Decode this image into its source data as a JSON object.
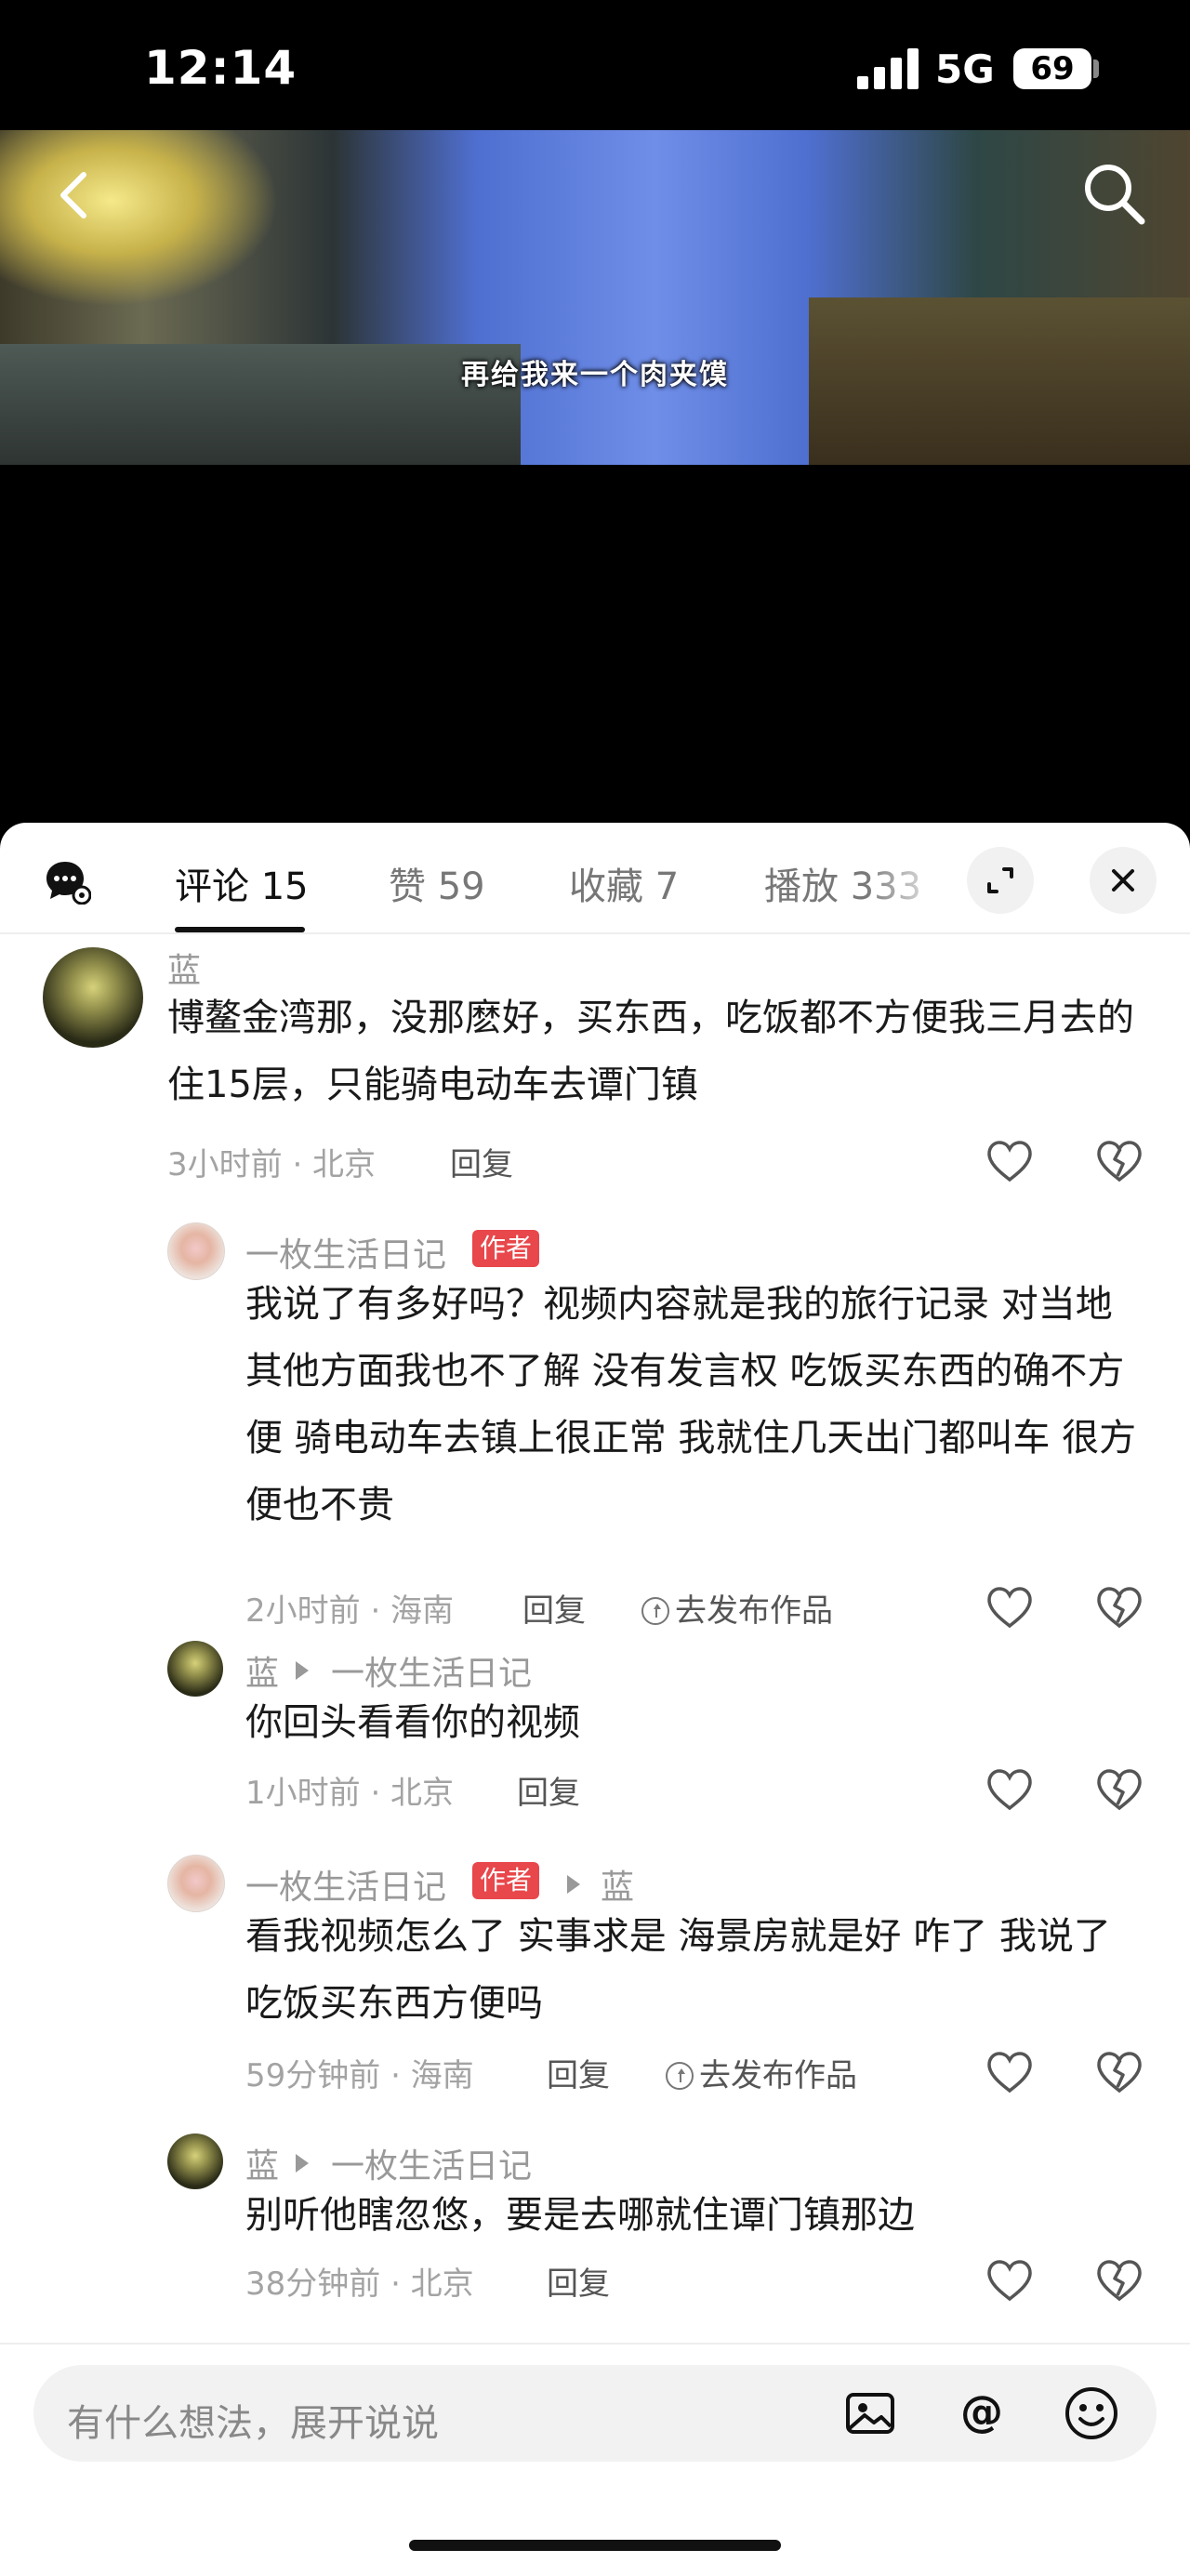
{
  "status": {
    "time": "12:14",
    "network": "5G",
    "battery": "69"
  },
  "video": {
    "subtitle": "再给我来一个肉夹馍"
  },
  "tabs": {
    "comments": "评论 15",
    "likes": "赞 59",
    "favorites": "收藏 7",
    "plays": "播放 333"
  },
  "comments": [
    {
      "user": "蓝",
      "text": "博鳌金湾那，没那麽好，买东西，吃饭都不方便我三月去的住15层，只能骑电动车去谭门镇",
      "meta": "3小时前 · 北京",
      "reply": "回复"
    },
    {
      "user": "一枚生活日记",
      "badge": "作者",
      "text": "我说了有多好吗？视频内容就是我的旅行记录 对当地其他方面我也不了解 没有发言权 吃饭买东西的确不方便 骑电动车去镇上很正常 我就住几天出门都叫车 很方便也不贵",
      "meta": "2小时前 · 海南",
      "reply": "回复",
      "publish": "去发布作品"
    },
    {
      "user": "蓝",
      "to": "一枚生活日记",
      "text": "你回头看看你的视频",
      "meta": "1小时前 · 北京",
      "reply": "回复"
    },
    {
      "user": "一枚生活日记",
      "badge": "作者",
      "to": "蓝",
      "text": "看我视频怎么了 实事求是 海景房就是好 咋了 我说了吃饭买东西方便吗",
      "meta": "59分钟前 · 海南",
      "reply": "回复",
      "publish": "去发布作品"
    },
    {
      "user": "蓝",
      "to": "一枚生活日记",
      "text": "别听他瞎忽悠，要是去哪就住谭门镇那边",
      "meta": "38分钟前 · 北京",
      "reply": "回复"
    }
  ],
  "input": {
    "placeholder": "有什么想法，展开说说"
  },
  "icons": {
    "back": "chevron-left-icon",
    "search": "search-icon",
    "chat": "chat-settings-icon",
    "expand": "expand-icon",
    "close": "close-icon",
    "like": "heart-icon",
    "dislike": "broken-heart-icon",
    "image": "image-icon",
    "mention": "at-icon",
    "emoji": "emoji-icon"
  },
  "colors": {
    "badge": "#e8474b",
    "panel": "#ffffff",
    "muted": "#999999"
  }
}
